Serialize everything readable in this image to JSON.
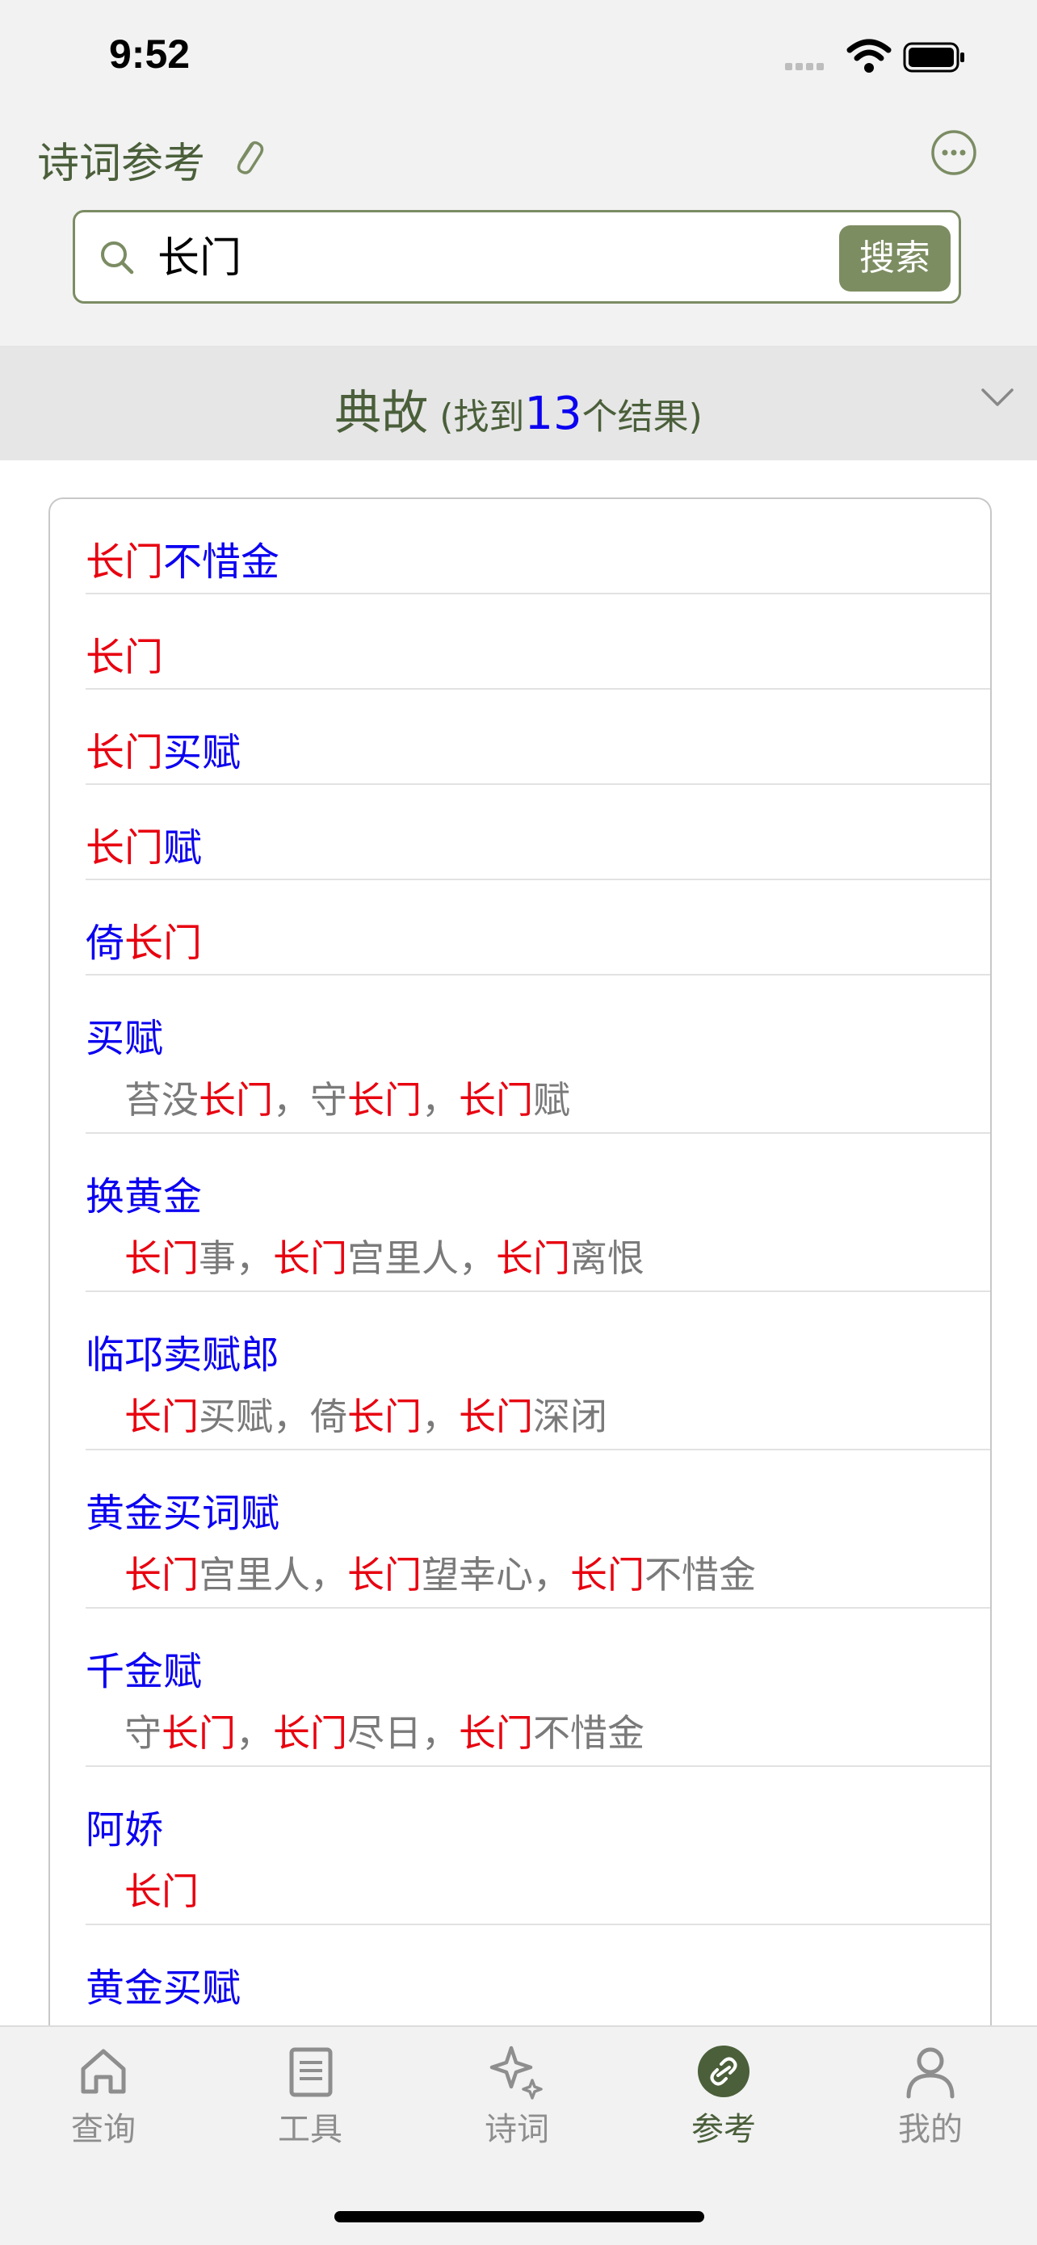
{
  "status_bar": {
    "time": "9:52"
  },
  "header": {
    "title": "诗词参考"
  },
  "search": {
    "value": "长门",
    "button_label": "搜索"
  },
  "section": {
    "title": "典故",
    "found_prefix": " (找到",
    "count": "13",
    "found_suffix": "个结果)"
  },
  "results": [
    {
      "title": [
        {
          "t": "长门",
          "c": "red"
        },
        {
          "t": "不惜金",
          "c": "blue"
        }
      ],
      "sub": []
    },
    {
      "title": [
        {
          "t": "长门",
          "c": "red"
        }
      ],
      "sub": []
    },
    {
      "title": [
        {
          "t": "长门",
          "c": "red"
        },
        {
          "t": "买赋",
          "c": "blue"
        }
      ],
      "sub": []
    },
    {
      "title": [
        {
          "t": "长门",
          "c": "red"
        },
        {
          "t": "赋",
          "c": "blue"
        }
      ],
      "sub": []
    },
    {
      "title": [
        {
          "t": "倚",
          "c": "blue"
        },
        {
          "t": "长门",
          "c": "red"
        }
      ],
      "sub": []
    },
    {
      "title": [
        {
          "t": "买赋",
          "c": "blue"
        }
      ],
      "sub": [
        {
          "t": "苔没",
          "c": "grey"
        },
        {
          "t": "长门",
          "c": "red"
        },
        {
          "t": "，守",
          "c": "grey"
        },
        {
          "t": "长门",
          "c": "red"
        },
        {
          "t": "，",
          "c": "grey"
        },
        {
          "t": "长门",
          "c": "red"
        },
        {
          "t": "赋",
          "c": "grey"
        }
      ]
    },
    {
      "title": [
        {
          "t": "换黄金",
          "c": "blue"
        }
      ],
      "sub": [
        {
          "t": "长门",
          "c": "red"
        },
        {
          "t": "事，",
          "c": "grey"
        },
        {
          "t": "长门",
          "c": "red"
        },
        {
          "t": "宫里人，",
          "c": "grey"
        },
        {
          "t": "长门",
          "c": "red"
        },
        {
          "t": "离恨",
          "c": "grey"
        }
      ]
    },
    {
      "title": [
        {
          "t": "临邛卖赋郎",
          "c": "blue"
        }
      ],
      "sub": [
        {
          "t": "长门",
          "c": "red"
        },
        {
          "t": "买赋，倚",
          "c": "grey"
        },
        {
          "t": "长门",
          "c": "red"
        },
        {
          "t": "，",
          "c": "grey"
        },
        {
          "t": "长门",
          "c": "red"
        },
        {
          "t": "深闭",
          "c": "grey"
        }
      ]
    },
    {
      "title": [
        {
          "t": "黄金买词赋",
          "c": "blue"
        }
      ],
      "sub": [
        {
          "t": "长门",
          "c": "red"
        },
        {
          "t": "宫里人，",
          "c": "grey"
        },
        {
          "t": "长门",
          "c": "red"
        },
        {
          "t": "望幸心，",
          "c": "grey"
        },
        {
          "t": "长门",
          "c": "red"
        },
        {
          "t": "不惜金",
          "c": "grey"
        }
      ]
    },
    {
      "title": [
        {
          "t": "千金赋",
          "c": "blue"
        }
      ],
      "sub": [
        {
          "t": "守",
          "c": "grey"
        },
        {
          "t": "长门",
          "c": "red"
        },
        {
          "t": "，",
          "c": "grey"
        },
        {
          "t": "长门",
          "c": "red"
        },
        {
          "t": "尽日，",
          "c": "grey"
        },
        {
          "t": "长门",
          "c": "red"
        },
        {
          "t": "不惜金",
          "c": "grey"
        }
      ]
    },
    {
      "title": [
        {
          "t": "阿娇",
          "c": "blue"
        }
      ],
      "sub": [
        {
          "t": "长门",
          "c": "red"
        }
      ]
    },
    {
      "title": [
        {
          "t": "黄金买赋",
          "c": "blue"
        }
      ],
      "sub": []
    }
  ],
  "tabs": [
    {
      "label": "查询",
      "icon": "home-icon",
      "active": false
    },
    {
      "label": "工具",
      "icon": "book-icon",
      "active": false
    },
    {
      "label": "诗词",
      "icon": "sparkle-icon",
      "active": false
    },
    {
      "label": "参考",
      "icon": "link-icon",
      "active": true
    },
    {
      "label": "我的",
      "icon": "person-icon",
      "active": false
    }
  ]
}
